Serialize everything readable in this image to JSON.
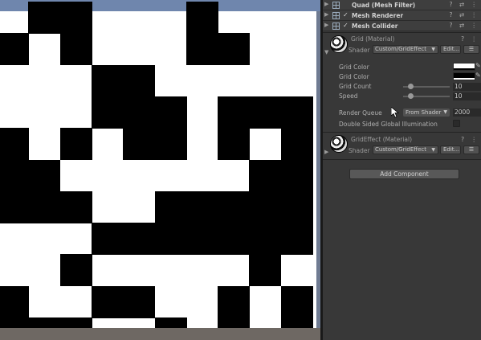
{
  "scene": {
    "pattern_colors": {
      "on": "#000000",
      "off": "#ffffff"
    },
    "sky_color": "#6f86ad",
    "ground_color": "#6e6863"
  },
  "inspector": {
    "components": [
      {
        "name": "Quad (Mesh Filter)",
        "checkable": false
      },
      {
        "name": "Mesh Renderer",
        "checkable": true,
        "checked": true
      },
      {
        "name": "Mesh Collider",
        "checkable": true,
        "checked": true
      }
    ],
    "header_buttons": "? ⇄ ⋮",
    "materials": [
      {
        "name": "Grid (Material)",
        "shader_label": "Shader",
        "shader": "Custom/GridEffect",
        "edit_label": "Edit...",
        "list_label": "☰",
        "expanded": true
      },
      {
        "name": "GridEffect (Material)",
        "shader_label": "Shader",
        "shader": "Custom/GridEffect",
        "edit_label": "Edit...",
        "list_label": "☰",
        "expanded": false
      }
    ],
    "properties": {
      "grid_color_1": {
        "label": "Grid Color",
        "color": "#ffffff"
      },
      "grid_color_2": {
        "label": "Grid Color",
        "color": "#000000"
      },
      "grid_count": {
        "label": "Grid Count",
        "value": "10",
        "slider_fraction": 0.15
      },
      "speed": {
        "label": "Speed",
        "value": "10",
        "slider_fraction": 0.15
      },
      "render_queue": {
        "label": "Render Queue",
        "mode": "From Shader",
        "value": "2000"
      },
      "double_sided_gi": {
        "label": "Double Sided Global Illumination",
        "checked": false
      }
    },
    "add_component_label": "Add Component"
  }
}
